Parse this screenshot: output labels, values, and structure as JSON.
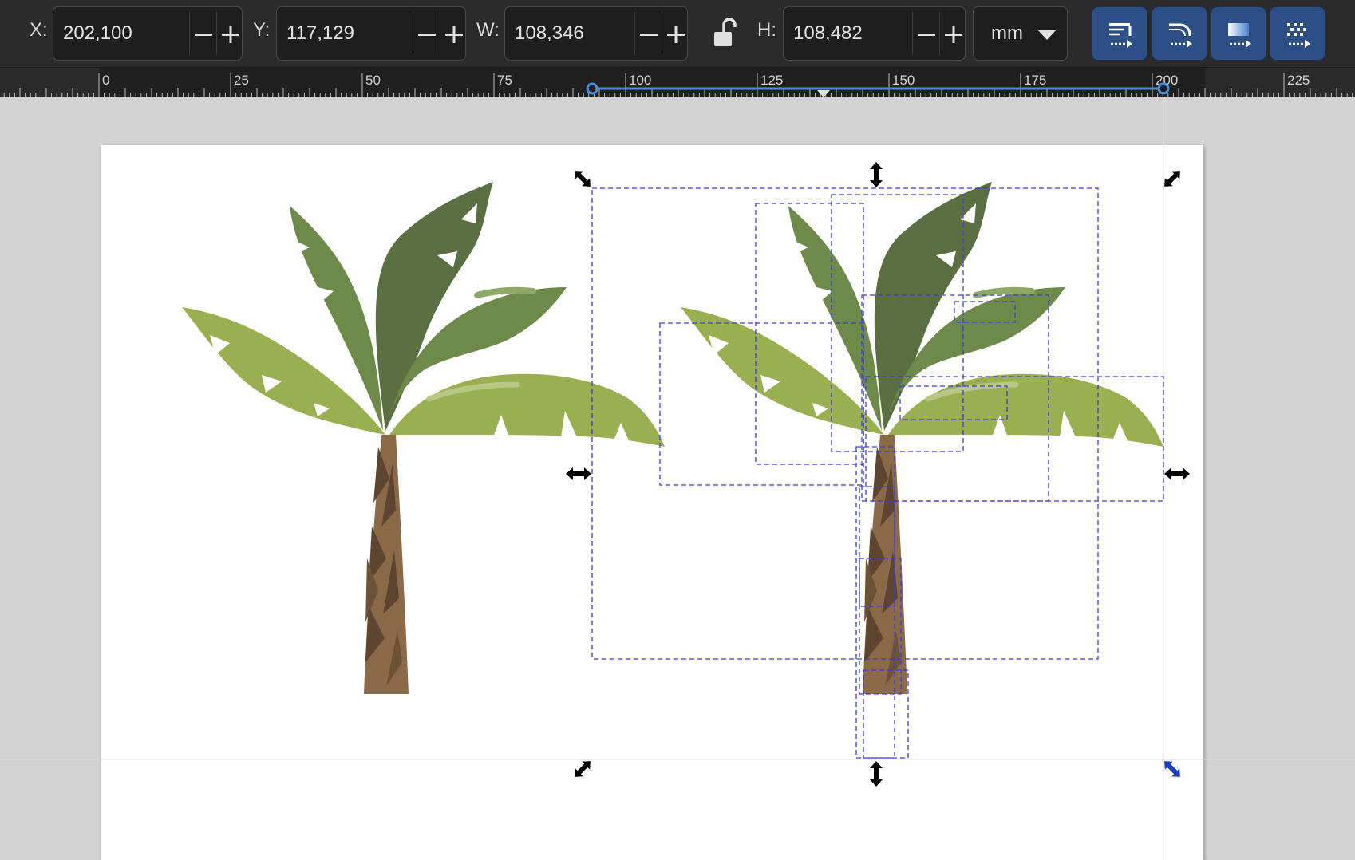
{
  "toolbar": {
    "x": {
      "label": "X:",
      "value": "202,100"
    },
    "y": {
      "label": "Y:",
      "value": "117,129"
    },
    "w": {
      "label": "W:",
      "value": "108,346"
    },
    "h": {
      "label": "H:",
      "value": "108,482"
    },
    "unit": "mm",
    "transform_buttons": [
      "scale-stroke-icon",
      "scale-corners-icon",
      "move-gradients-icon",
      "move-patterns-icon"
    ]
  },
  "ruler": {
    "labels": [
      "0",
      "25",
      "50",
      "75",
      "100",
      "125",
      "150",
      "175",
      "200",
      "225"
    ]
  },
  "colors": {
    "toolbar_bg": "#2b2b2b",
    "accent_button": "#2d4f86",
    "ruler_selection": "#4a90d9",
    "selection_box": "#3b3bd6",
    "leaf_light": "#9aae52",
    "leaf_mid": "#6d8a4a",
    "leaf_dark": "#5a6f42",
    "trunk_light": "#8a6a48",
    "trunk_dark": "#5e4530"
  }
}
